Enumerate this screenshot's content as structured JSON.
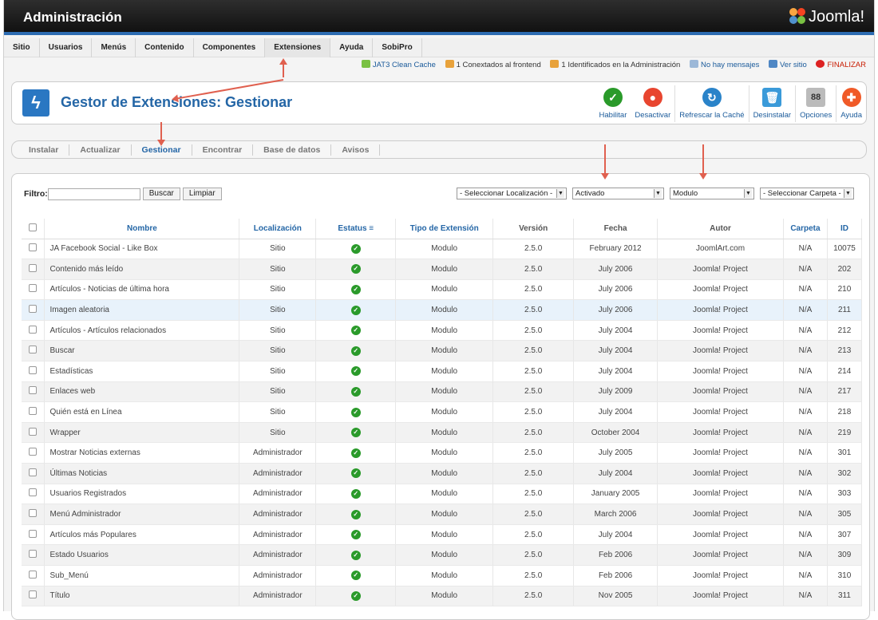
{
  "app": {
    "title": "Administración",
    "logo_text": "Joomla!"
  },
  "menu": [
    "Sitio",
    "Usuarios",
    "Menús",
    "Contenido",
    "Componentes",
    "Extensiones",
    "Ayuda",
    "SobiPro"
  ],
  "status": {
    "cache": "JAT3 Clean Cache",
    "frontend": "1 Conextados al frontend",
    "admin": "1 Identificados en la Administración",
    "messages": "No hay mensajes",
    "view_site": "Ver sitio",
    "logout": "FINALIZAR"
  },
  "page_title": "Gestor de Extensiones: Gestionar",
  "toolbar": [
    "Habilitar",
    "Desactivar",
    "Refrescar la Caché",
    "Desinstalar",
    "Opciones",
    "Ayuda"
  ],
  "subnav": [
    "Instalar",
    "Actualizar",
    "Gestionar",
    "Encontrar",
    "Base de datos",
    "Avisos"
  ],
  "filter": {
    "label": "Filtro:",
    "value": "",
    "search_btn": "Buscar",
    "clear_btn": "Limpiar",
    "location": "- Seleccionar Localización -",
    "state": "Activado",
    "type": "Modulo",
    "folder": "- Seleccionar Carpeta -"
  },
  "columns": [
    "Nombre",
    "Localización",
    "Estatus",
    "Tipo de Extensión",
    "Versión",
    "Fecha",
    "Autor",
    "Carpeta",
    "ID"
  ],
  "rows": [
    [
      "JA Facebook Social - Like Box",
      "Sitio",
      "Modulo",
      "2.5.0",
      "February 2012",
      "JoomlArt.com",
      "N/A",
      "10075"
    ],
    [
      "Contenido más leído",
      "Sitio",
      "Modulo",
      "2.5.0",
      "July 2006",
      "Joomla! Project",
      "N/A",
      "202"
    ],
    [
      "Artículos - Noticias de última hora",
      "Sitio",
      "Modulo",
      "2.5.0",
      "July 2006",
      "Joomla! Project",
      "N/A",
      "210"
    ],
    [
      "Imagen aleatoria",
      "Sitio",
      "Modulo",
      "2.5.0",
      "July 2006",
      "Joomla! Project",
      "N/A",
      "211"
    ],
    [
      "Artículos - Artículos relacionados",
      "Sitio",
      "Modulo",
      "2.5.0",
      "July 2004",
      "Joomla! Project",
      "N/A",
      "212"
    ],
    [
      "Buscar",
      "Sitio",
      "Modulo",
      "2.5.0",
      "July 2004",
      "Joomla! Project",
      "N/A",
      "213"
    ],
    [
      "Estadísticas",
      "Sitio",
      "Modulo",
      "2.5.0",
      "July 2004",
      "Joomla! Project",
      "N/A",
      "214"
    ],
    [
      "Enlaces web",
      "Sitio",
      "Modulo",
      "2.5.0",
      "July 2009",
      "Joomla! Project",
      "N/A",
      "217"
    ],
    [
      "Quién está en Línea",
      "Sitio",
      "Modulo",
      "2.5.0",
      "July 2004",
      "Joomla! Project",
      "N/A",
      "218"
    ],
    [
      "Wrapper",
      "Sitio",
      "Modulo",
      "2.5.0",
      "October 2004",
      "Joomla! Project",
      "N/A",
      "219"
    ],
    [
      "Mostrar Noticias externas",
      "Administrador",
      "Modulo",
      "2.5.0",
      "July 2005",
      "Joomla! Project",
      "N/A",
      "301"
    ],
    [
      "Últimas Noticias",
      "Administrador",
      "Modulo",
      "2.5.0",
      "July 2004",
      "Joomla! Project",
      "N/A",
      "302"
    ],
    [
      "Usuarios Registrados",
      "Administrador",
      "Modulo",
      "2.5.0",
      "January 2005",
      "Joomla! Project",
      "N/A",
      "303"
    ],
    [
      "Menú Administrador",
      "Administrador",
      "Modulo",
      "2.5.0",
      "March 2006",
      "Joomla! Project",
      "N/A",
      "305"
    ],
    [
      "Artículos más Populares",
      "Administrador",
      "Modulo",
      "2.5.0",
      "July 2004",
      "Joomla! Project",
      "N/A",
      "307"
    ],
    [
      "Estado Usuarios",
      "Administrador",
      "Modulo",
      "2.5.0",
      "Feb 2006",
      "Joomla! Project",
      "N/A",
      "309"
    ],
    [
      "Sub_Menú",
      "Administrador",
      "Modulo",
      "2.5.0",
      "Feb 2006",
      "Joomla! Project",
      "N/A",
      "310"
    ],
    [
      "Título",
      "Administrador",
      "Modulo",
      "2.5.0",
      "Nov 2005",
      "Joomla! Project",
      "N/A",
      "311"
    ]
  ],
  "colors": {
    "accent": "#2466a6",
    "annotation": "#e0604f",
    "ok": "#2a9a2a"
  }
}
